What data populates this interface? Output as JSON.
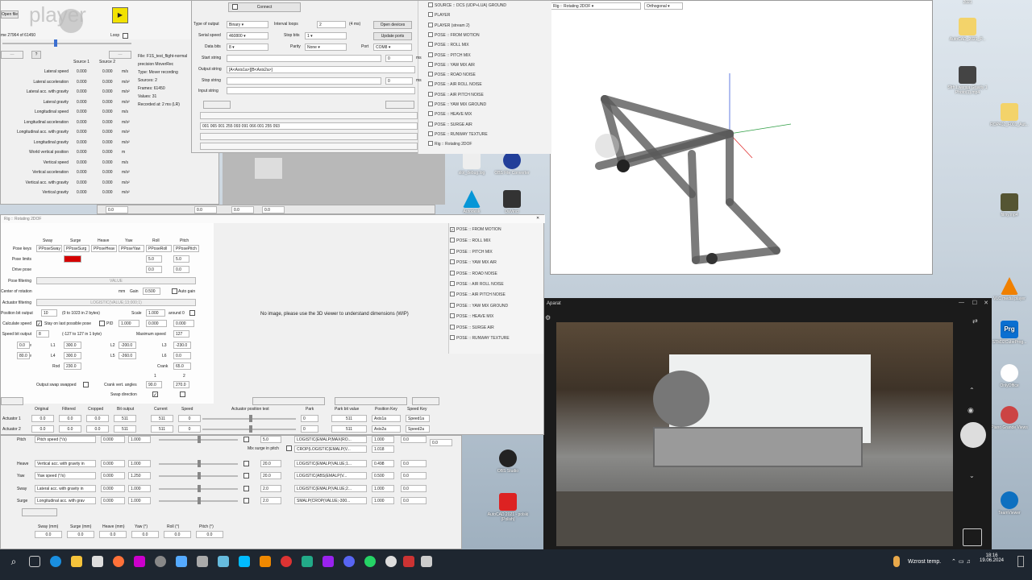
{
  "desktop": {
    "icons": [
      {
        "label": "2021"
      },
      {
        "label": "AutoCAD_2021_P..."
      },
      {
        "label": "Sfrh I wersja Gravity 1 Photo(1).mp4"
      },
      {
        "label": "ROP402_F001_Aut..."
      },
      {
        "label": "filmy.mp4"
      },
      {
        "label": "VLC media player"
      },
      {
        "label": "STM32CubeProg..."
      },
      {
        "label": "OnlyOffice"
      },
      {
        "label": "Piano Grande Views"
      },
      {
        "label": "TeamViewer"
      },
      {
        "label": "OBS Studio"
      },
      {
        "label": "AutoCAD 2021 - polski (Polish)"
      },
      {
        "label": "slot_debug.log"
      },
      {
        "label": "OBS File Converter"
      },
      {
        "label": "DaVinci"
      },
      {
        "label": "Autodesk"
      }
    ]
  },
  "player": {
    "logo_text": "player",
    "open_file": "Open file",
    "frame_text": "me 27964 of 61450",
    "loop_label": "Loop",
    "source1": "Source 1",
    "source2": "Source 2",
    "file_info": [
      "File: F1S_test_flight-normal",
      "precision MoverRec",
      "Type: Mover recording",
      "Sources: 2",
      "Frames: 61450",
      "Values: 31",
      "Recorded at: 2 ms (LR)"
    ],
    "rows": [
      {
        "label": "Lateral speed",
        "v1": "0.000",
        "v2": "0.000",
        "unit": "m/s"
      },
      {
        "label": "Lateral acceleration",
        "v1": "0.000",
        "v2": "0.000",
        "unit": "m/s²"
      },
      {
        "label": "Lateral acc. with gravity",
        "v1": "0.000",
        "v2": "0.000",
        "unit": "m/s²"
      },
      {
        "label": "Lateral gravity",
        "v1": "0.000",
        "v2": "0.000",
        "unit": "m/s²"
      },
      {
        "label": "Longitudinal speed",
        "v1": "0.000",
        "v2": "0.000",
        "unit": "m/s"
      },
      {
        "label": "Longitudinal acceleration",
        "v1": "0.000",
        "v2": "0.000",
        "unit": "m/s²"
      },
      {
        "label": "Longitudinal acc. with gravity",
        "v1": "0.000",
        "v2": "0.000",
        "unit": "m/s²"
      },
      {
        "label": "Longitudinal gravity",
        "v1": "0.000",
        "v2": "0.000",
        "unit": "m/s²"
      },
      {
        "label": "World vertical position",
        "v1": "0.000",
        "v2": "0.000",
        "unit": "m"
      },
      {
        "label": "Vertical speed",
        "v1": "0.000",
        "v2": "0.000",
        "unit": "m/s"
      },
      {
        "label": "Vertical acceleration",
        "v1": "0.000",
        "v2": "0.000",
        "unit": "m/s²"
      },
      {
        "label": "Vertical acc. with gravity",
        "v1": "0.000",
        "v2": "0.000",
        "unit": "m/s²"
      },
      {
        "label": "Vertical gravity",
        "v1": "0.000",
        "v2": "0.000",
        "unit": "m/s²"
      }
    ],
    "bottom_values": [
      "0.0",
      "0.0",
      "0.0",
      "0.0"
    ]
  },
  "serial": {
    "connect": "Connect",
    "type_of_output_label": "Type of output",
    "type_of_output": "Binary",
    "interval_label": "Interval loops",
    "interval": "2",
    "interval_unit": "(4 ms)",
    "open_devices": "Open devices",
    "serial_speed_label": "Serial speed",
    "serial_speed": "460800",
    "stop_bits_label": "Stop bits",
    "stop_bits": "1",
    "update_ports": "Update ports",
    "data_bits_label": "Data bits",
    "data_bits": "8",
    "parity_label": "Parity",
    "parity": "None",
    "port_label": "Port",
    "port": "COM8",
    "start_string_label": "Start string",
    "start_ms": "0",
    "ms": "ms",
    "output_string_label": "Output string",
    "output_string": "[A<Axis1a>][B<Axis2a>]",
    "stop_string_label": "Stop string",
    "stop_ms": "0",
    "input_string_label": "Input string",
    "log_line": "001 065 001 255 093 091 066 001 255 093"
  },
  "sources_list": [
    "SOURCE :: DCS (UDP+LUA) GROUND",
    "PLAYER",
    "PLAYER (stream 2)",
    "POSE :: FROM MOTION",
    "POSE :: ROLL MIX",
    "POSE :: PITCH MIX",
    "POSE :: YAW MIX AIR",
    "POSE :: ROAD NOISE",
    "POSE :: AIR ROLL NOISE",
    "POSE :: AIR PITCH NOISE",
    "POSE :: YAW MIX GROUND",
    "POSE :: HEAVE MIX",
    "POSE :: SURGE AIR",
    "POSE :: RUNWAY TEXTURE",
    "Rig :: Rotating 2DOF"
  ],
  "viewer3d": {
    "title": "Rig :: Rotating 2DOF",
    "projection": "Orthogonal"
  },
  "rig": {
    "title": "Rig :: Rotating 2DOF",
    "axes": [
      "Sway",
      "Surge",
      "Heave",
      "Yaw",
      "Roll",
      "Pitch"
    ],
    "pose_keys_label": "Pose keys",
    "pose_keys": [
      "PPoseSway",
      "PPoseSurg",
      "PPoseHeav",
      "PPoseYaw",
      "PPoseRoll",
      "PPosePitch"
    ],
    "pose_limits_label": "Pose limits",
    "roll_limits": [
      "5.0",
      "5.0"
    ],
    "drive_pose_label": "Drive pose",
    "drive_pose_vals": [
      "0.0",
      "0.0"
    ],
    "pose_filtering_label": "Pose filtering",
    "value_text": "VALUE",
    "center_label": "Center of rotation",
    "mm": "mm",
    "gain_label": "Gain",
    "gain": "0.500",
    "auto_gain": "Auto gain",
    "actuator_filtering_label": "Actuator filtering",
    "actuator_filtering": "LOGISTIC(VALUE;13;000;1)",
    "position_bit_label": "Position bit output",
    "position_bit": "10",
    "position_bit_note": "(0 to 1023 in 2 bytes)",
    "scale_label": "Scale",
    "scale": "1.000",
    "around0": "around 0",
    "calc_speed_label": "Calculate speed",
    "stay_last": "Stay on last possible pose",
    "pid_label": "PID",
    "pid_vals": [
      "1.000",
      "0.000",
      "0.000"
    ],
    "speed_bit_label": "Speed bit output",
    "speed_bit": "8",
    "speed_bit_note": "(-127 to 127 in 1 byte)",
    "max_speed_label": "Maximum speed",
    "max_speed": "127",
    "middle_label": "Middle",
    "middle_vals": [
      "0.0",
      "0.0"
    ],
    "range_label": "Range",
    "range_vals": [
      "80.0",
      "80.0"
    ],
    "l1_label": "L1",
    "l1": "300.0",
    "l4_label": "L4",
    "l4": "300.0",
    "l2_label": "L2",
    "l2": "-200.0",
    "l5_label": "L5",
    "l5": "-260.0",
    "l3_label": "L3",
    "l3": "-230.0",
    "l6_label": "L6",
    "l6": "0.0",
    "rod_label": "Rod",
    "rod": "230.0",
    "crank_label": "Crank",
    "crank": "65.0",
    "col1": "1",
    "col2": "2",
    "output_swap_label": "Output swap swapped",
    "crank_vert_label": "Crank vert. angles",
    "crank_vert": [
      "90.0",
      "270.0"
    ],
    "swap_dir_label": "Swap direction",
    "no_image": "No image, please use the 3D viewer to understand dimensions (WIP)"
  },
  "pose_list": [
    "POSE :: FROM MOTION",
    "POSE :: ROLL MIX",
    "POSE :: PITCH MIX",
    "POSE :: YAW MIX AIR",
    "POSE :: ROAD NOISE",
    "POSE :: AIR ROLL NOISE",
    "POSE :: AIR PITCH NOISE",
    "POSE :: YAW MIX GROUND",
    "POSE :: HEAVE MIX",
    "POSE :: SURGE AIR",
    "POSE :: RUNWAY TEXTURE"
  ],
  "actuators": {
    "headers": [
      "Original",
      "Filtered",
      "Cropped",
      "Bit output",
      "Current",
      "Speed",
      "Actuator position test",
      "Park",
      "Park bit value",
      "Position Key",
      "Speed Key"
    ],
    "rows": [
      {
        "label": "Actuator 1",
        "orig": "0.0",
        "filt": "0.0",
        "crop": "0.0",
        "bit": "511",
        "cur": "511",
        "spd": "0",
        "park": "0",
        "park_bit": "511",
        "pos_key": "Axis1a",
        "spd_key": "Speed1a"
      },
      {
        "label": "Actuator 2",
        "orig": "0.0",
        "filt": "0.0",
        "crop": "0.0",
        "bit": "511",
        "cur": "511",
        "spd": "0",
        "park": "0",
        "park_bit": "511",
        "pos_key": "Axis2a",
        "spd_key": "Speed2a"
      }
    ]
  },
  "mixer": {
    "rows": [
      {
        "axis": "Pitch",
        "source": "Pitch speed (°/s)",
        "a": "0.000",
        "b": "1.000",
        "lim": "5.0",
        "expr": "LOGISTIC(EMALP(MAX(RO...",
        "g": "1.000",
        "o": "0.0"
      },
      {
        "axis": "Heave",
        "source": "Vertical acc. with gravity in",
        "a": "0.000",
        "b": "1.000",
        "lim": "20.0",
        "expr": "LOGISTIC(EMALP(VALUE;1...",
        "g": "0.498",
        "o": "0.0"
      },
      {
        "axis": "Yaw",
        "source": "Yaw speed (°/s)",
        "a": "0.000",
        "b": "1.250",
        "lim": "20.0",
        "expr": "LOGISTIC(ABS(EMALP(V...",
        "g": "0.500",
        "o": "0.0"
      },
      {
        "axis": "Sway",
        "source": "Lateral acc. with gravity in",
        "a": "0.000",
        "b": "1.000",
        "lim": "2.0",
        "expr": "LOGISTIC(EMALP(VALUE;2...",
        "g": "1.000",
        "o": "0.0"
      },
      {
        "axis": "Surge",
        "source": "Longitudinal acc. with grav",
        "a": "0.000",
        "b": "1.000",
        "lim": "2.0",
        "expr": "SMALP(CROP(VALUE;-300...",
        "g": "1.000",
        "o": "0.0"
      }
    ],
    "crop_expr": "CROP(LOGISTIC(EMALP(V...",
    "crop_g": "1.018",
    "mix_surge": "Mix surge in pitch",
    "extra_val": "0.0",
    "outputs": [
      {
        "label": "Sway (mm)",
        "v": "0.0"
      },
      {
        "label": "Surge (mm)",
        "v": "0.0"
      },
      {
        "label": "Heave (mm)",
        "v": "0.0"
      },
      {
        "label": "Yaw (°)",
        "v": "0.0"
      },
      {
        "label": "Roll (°)",
        "v": "0.0"
      },
      {
        "label": "Pitch (°)",
        "v": "0.0"
      }
    ]
  },
  "camera": {
    "title": "Aparat"
  },
  "taskbar": {
    "weather": "Wzrost temp.",
    "time": "18:16",
    "date": "19.06.2024"
  },
  "colors": {
    "accent": "#0078d4",
    "limit_red": "#d40000",
    "taskbar": "#1e2630"
  }
}
